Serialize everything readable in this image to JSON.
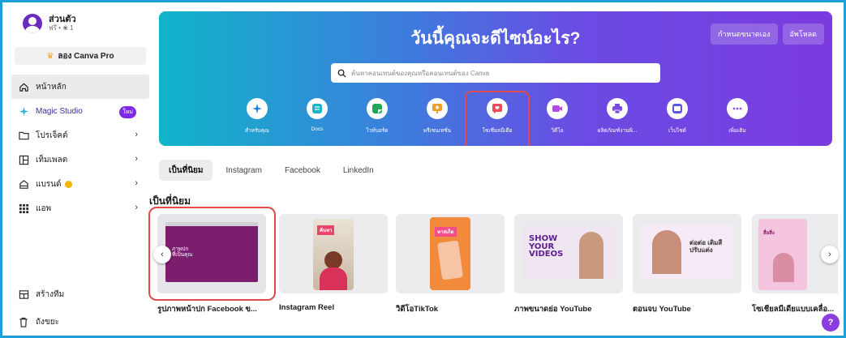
{
  "account": {
    "name": "ส่วนตัว",
    "sub": "ฟรี • ❀ 1"
  },
  "pro_button": {
    "label": "ลอง Canva Pro"
  },
  "nav": [
    {
      "label": "หน้าหลัก",
      "icon": "home-icon"
    },
    {
      "label": "Magic Studio",
      "icon": "magic-sparkle-icon",
      "badge": "ใหม่"
    },
    {
      "label": "โปรเจ็คต์",
      "icon": "folder-icon"
    },
    {
      "label": "เท็มเพลต",
      "icon": "templates-icon"
    },
    {
      "label": "แบรนด์",
      "icon": "brand-icon"
    },
    {
      "label": "แอพ",
      "icon": "apps-grid-icon"
    }
  ],
  "nav_bottom": [
    {
      "label": "สร้างทีม",
      "icon": "team-icon"
    },
    {
      "label": "ถังขยะ",
      "icon": "trash-icon"
    }
  ],
  "hero": {
    "title": "วันนี้คุณจะดีไซน์อะไร?",
    "custom_size": "กำหนดขนาดเอง",
    "upload": "อัพโหลด",
    "search_placeholder": "ค้นหาคอนเทนต์ของคุณหรือคอนเทนต์ของ Canva"
  },
  "categories": [
    {
      "label": "สำหรับคุณ",
      "icon": "sparkle-icon",
      "color": "#1b7de0"
    },
    {
      "label": "Docs",
      "icon": "docs-icon",
      "color": "#19b4c4"
    },
    {
      "label": "ไวท์บอร์ด",
      "icon": "whiteboard-icon",
      "color": "#1fa855"
    },
    {
      "label": "พรีเซนเทชั่น",
      "icon": "presentation-icon",
      "color": "#f29e2b"
    },
    {
      "label": "โซเชียลมีเดีย",
      "icon": "social-media-icon",
      "color": "#e84c5b"
    },
    {
      "label": "วิดีโอ",
      "icon": "video-icon",
      "color": "#b847e8"
    },
    {
      "label": "ผลิตภัณฑ์งานพิ...",
      "icon": "print-icon",
      "color": "#7a4be0"
    },
    {
      "label": "เว็บไซต์",
      "icon": "website-icon",
      "color": "#5a57e6"
    },
    {
      "label": "เพิ่มเติม",
      "icon": "more-icon",
      "color": "#8b54e6"
    }
  ],
  "tabs": [
    "เป็นที่นิยม",
    "Instagram",
    "Facebook",
    "LinkedIn"
  ],
  "section_title": "เป็นที่นิยม",
  "cards": [
    {
      "label": "รูปภาพหน้าปก Facebook ข...",
      "thumb_text": "ภาพปก\nที่เป็นคุณ"
    },
    {
      "label": "Instagram Reel",
      "thumb_text": "ค้นหา"
    },
    {
      "label": "วิดีโอTikTok",
      "thumb_text": "หาสเก็ต"
    },
    {
      "label": "ภาพขนาดย่อ YouTube",
      "thumb_text": "SHOW YOUR VIDEOS"
    },
    {
      "label": "ตอนจบ YouTube",
      "thumb_text": "ต่อต่อ เติมสี ปรับแต่ง"
    },
    {
      "label": "โซเชียลมีเดียแบบเคลื่อ...",
      "thumb_text": "สื่อสิ่ง"
    }
  ],
  "help": {
    "label": "?"
  }
}
